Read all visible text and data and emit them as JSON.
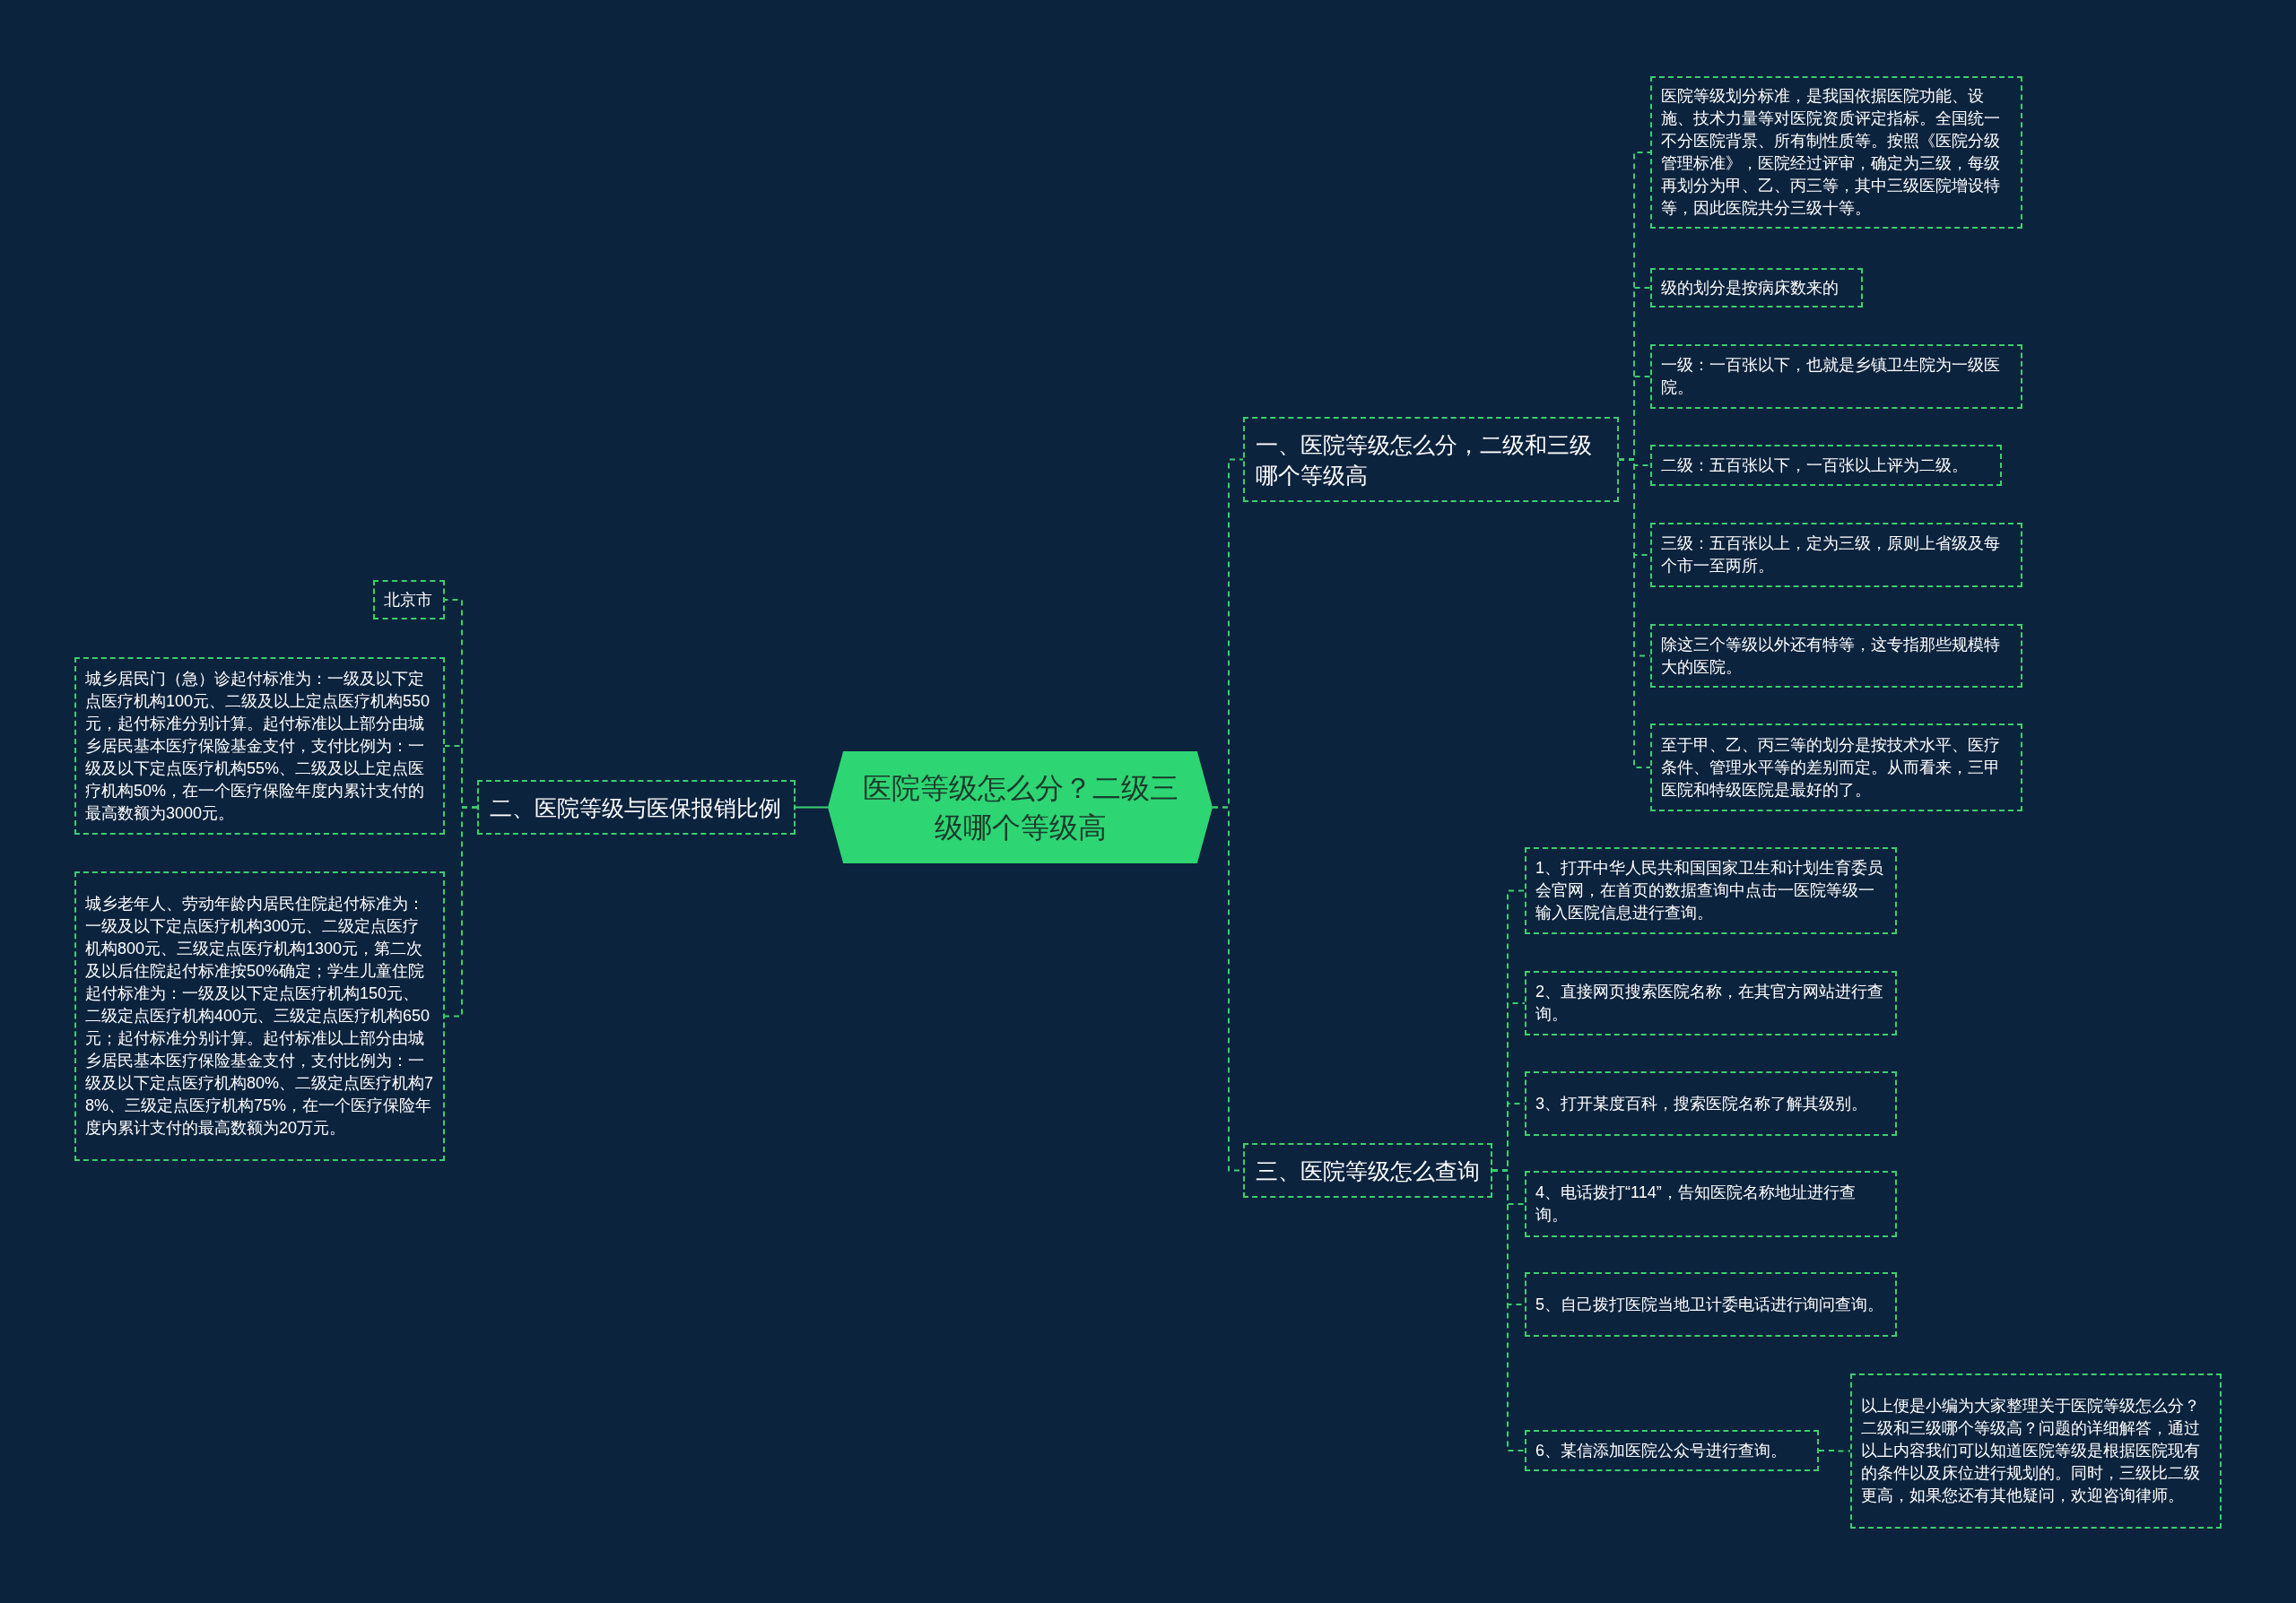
{
  "root": {
    "title": "医院等级怎么分？二级三级哪个等级高"
  },
  "branches": [
    {
      "title": "一、医院等级怎么分，二级和三级哪个等级高",
      "children": [
        {
          "text": "医院等级划分标准，是我国依据医院功能、设施、技术力量等对医院资质评定指标。全国统一不分医院背景、所有制性质等。按照《医院分级管理标准》，医院经过评审，确定为三级，每级再划分为甲、乙、丙三等，其中三级医院增设特等，因此医院共分三级十等。"
        },
        {
          "text": "级的划分是按病床数来的"
        },
        {
          "text": "一级：一百张以下，也就是乡镇卫生院为一级医院。"
        },
        {
          "text": "二级：五百张以下，一百张以上评为二级。"
        },
        {
          "text": "三级：五百张以上，定为三级，原则上省级及每个市一至两所。"
        },
        {
          "text": "除这三个等级以外还有特等，这专指那些规模特大的医院。"
        },
        {
          "text": "至于甲、乙、丙三等的划分是按技术水平、医疗条件、管理水平等的差别而定。从而看来，三甲医院和特级医院是最好的了。"
        }
      ]
    },
    {
      "title": "二、医院等级与医保报销比例",
      "children": [
        {
          "text": "北京市"
        },
        {
          "text": "城乡居民门（急）诊起付标准为：一级及以下定点医疗机构100元、二级及以上定点医疗机构550元，起付标准分别计算。起付标准以上部分由城乡居民基本医疗保险基金支付，支付比例为：一级及以下定点医疗机构55%、二级及以上定点医疗机构50%，在一个医疗保险年度内累计支付的最高数额为3000元。"
        },
        {
          "text": "城乡老年人、劳动年龄内居民住院起付标准为：一级及以下定点医疗机构300元、二级定点医疗机构800元、三级定点医疗机构1300元，第二次及以后住院起付标准按50%确定；学生儿童住院起付标准为：一级及以下定点医疗机构150元、二级定点医疗机构400元、三级定点医疗机构650元；起付标准分别计算。起付标准以上部分由城乡居民基本医疗保险基金支付，支付比例为：一级及以下定点医疗机构80%、二级定点医疗机构78%、三级定点医疗机构75%，在一个医疗保险年度内累计支付的最高数额为20万元。"
        }
      ]
    },
    {
      "title": "三、医院等级怎么查询",
      "children": [
        {
          "text": "1、打开中华人民共和国国家卫生和计划生育委员会官网，在首页的数据查询中点击一医院等级一输入医院信息进行查询。"
        },
        {
          "text": "2、直接网页搜索医院名称，在其官方网站进行查询。"
        },
        {
          "text": "3、打开某度百科，搜索医院名称了解其级别。"
        },
        {
          "text": "4、电话拨打“114”，告知医院名称地址进行查询。"
        },
        {
          "text": "5、自己拨打医院当地卫计委电话进行询问查询。"
        },
        {
          "text": "6、某信添加医院公众号进行查询。",
          "children": [
            {
              "text": "以上便是小编为大家整理关于医院等级怎么分？二级和三级哪个等级高？问题的详细解答，通过以上内容我们可以知道医院等级是根据医院现有的条件以及床位进行规划的。同时，三级比二级更高，如果您还有其他疑问，欢迎咨询律师。"
            }
          ]
        }
      ]
    }
  ]
}
